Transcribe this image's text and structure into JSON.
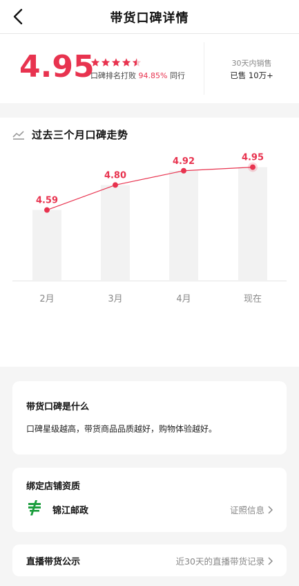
{
  "header": {
    "title": "带货口碑详情"
  },
  "score": {
    "value": "4.95",
    "stars": 4.5,
    "rank_prefix": "口碑排名打败",
    "rank_percent": "94.85%",
    "rank_suffix": "同行"
  },
  "sales": {
    "label": "30天内销售",
    "value": "已售 10万+"
  },
  "trend": {
    "title": "过去三个月口碑走势"
  },
  "chart_data": {
    "type": "line",
    "categories": [
      "2月",
      "3月",
      "4月",
      "现在"
    ],
    "values": [
      4.59,
      4.8,
      4.92,
      4.95
    ],
    "value_labels": [
      "4.59",
      "4.80",
      "4.92",
      "4.95"
    ],
    "colors": {
      "line": "#e8334f",
      "bar": "#f2f2f2",
      "axis_label": "#888888"
    }
  },
  "what_card": {
    "title": "带货口碑是什么",
    "description": "口碑星级越高，带货商品品质越好，购物体验越好。"
  },
  "store_card": {
    "title": "绑定店铺资质",
    "store_name": "锦江邮政",
    "link_label": "证照信息"
  },
  "live_card": {
    "title": "直播带货公示",
    "link_label": "近30天的直播带货记录"
  },
  "colors": {
    "accent": "#e8334f",
    "store_logo": "#1a9d3c"
  }
}
